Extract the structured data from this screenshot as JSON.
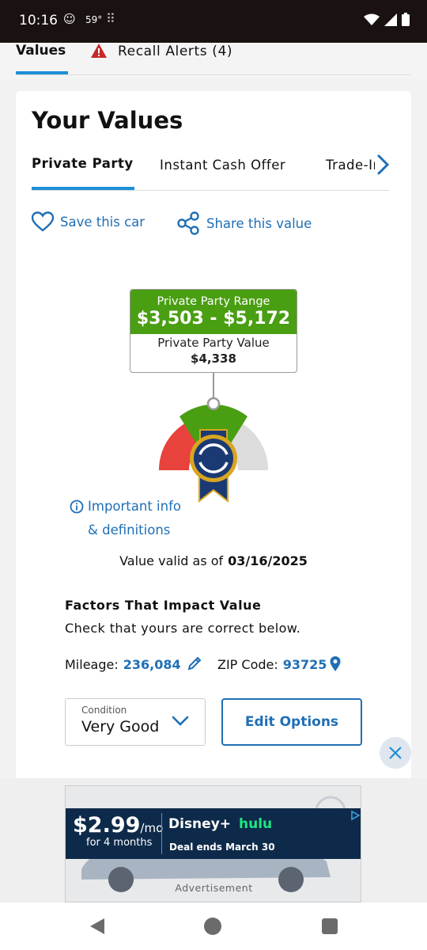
{
  "status_bar": {
    "time": "10:16",
    "temperature": "59°"
  },
  "top_tabs": {
    "values": "Values",
    "recall_alerts": "Recall Alerts (4)"
  },
  "card": {
    "title": "Your Values",
    "value_tabs": [
      "Private Party",
      "Instant Cash Offer",
      "Trade-In"
    ],
    "save_link": "Save this car",
    "share_link": "Share this value",
    "range_label": "Private Party Range",
    "range_value": "$3,503 - $5,172",
    "ppv_label": "Private Party Value",
    "ppv_value": "$4,338",
    "info_line1": "Important info",
    "info_line2": "& definitions",
    "valid_label": "Value valid as of",
    "valid_date": "03/16/2025",
    "factors_title": "Factors That Impact Value",
    "factors_subtitle": "Check that yours are correct below.",
    "mileage_label": "Mileage:",
    "mileage_value": "236,084",
    "zip_label": "ZIP Code:",
    "zip_value": "93725",
    "condition_label": "Condition",
    "condition_value": "Very Good",
    "edit_options": "Edit Options"
  },
  "ad": {
    "price": "$2.99",
    "price_unit": "/mo",
    "term": "for 4 months",
    "brand1": "Disney+",
    "brand2": "hulu",
    "deal": "Deal ends March 30",
    "label": "Advertisement"
  },
  "colors": {
    "accent": "#1f6fb5",
    "tab_underline": "#1d8fd6",
    "range_green": "#4a9e12",
    "gauge_red": "#e8423c",
    "ribbon_navy": "#1b3a73"
  }
}
